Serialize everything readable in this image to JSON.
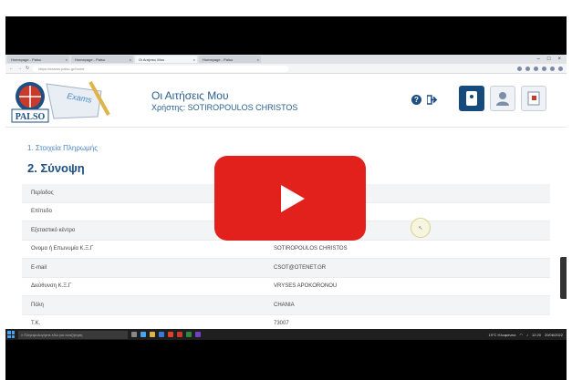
{
  "browser": {
    "tabs": [
      {
        "label": "Homepage - Palso",
        "active": false
      },
      {
        "label": "Homepage - Palso",
        "active": false
      },
      {
        "label": "Οι Αιτήσεις Μου",
        "active": true
      },
      {
        "label": "Homepage - Palso",
        "active": false
      }
    ],
    "url": "https://exams.palso.gr/home"
  },
  "header": {
    "logo_text": "PALSO",
    "logo_tag": "Exams",
    "title": "Οι Αιτήσεις Μου",
    "user_line": "Χρήστης: SOTIROPOULOS CHRISTOS",
    "help_symbol": "?",
    "logout_icon": "logout-icon"
  },
  "content": {
    "step1_label": "1. Στοιχεία Πληρωμής",
    "step2_title": "2. Σύνοψη",
    "rows": [
      {
        "key": "Περίοδος",
        "value": ""
      },
      {
        "key": "Επίπεδο",
        "value": ""
      },
      {
        "key": "Εξεταστικό κέντρο",
        "value": ""
      },
      {
        "key": "Ονομα ή Επωνυμία Κ.Ξ.Γ",
        "value": "SOTIROPOULOS CHRISTOS"
      },
      {
        "key": "E-mail",
        "value": "CSOT@OTENET.GR"
      },
      {
        "key": "Διεύθυνση Κ.Ξ.Γ",
        "value": "VRYSES APOKORONOU"
      },
      {
        "key": "Πόλη",
        "value": "CHANIA"
      },
      {
        "key": "Τ.Κ.",
        "value": "73007"
      }
    ]
  },
  "taskbar": {
    "search_placeholder": "Πληκτρολογήστε εδώ για αναζήτηση",
    "weather": "19°C Ηλιοφάνεια",
    "time": "12:20",
    "date": "20/06/2022"
  },
  "colors": {
    "brand_blue": "#1d4f82",
    "link_blue": "#4a86c5",
    "yt_red": "#e2211c"
  }
}
